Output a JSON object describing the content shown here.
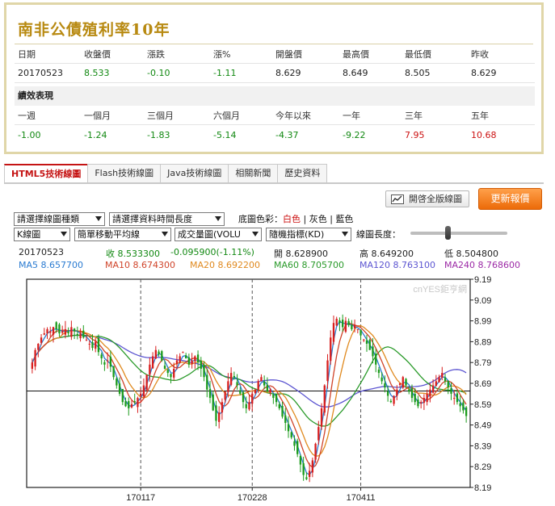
{
  "quote": {
    "title": "南非公債殖利率10年",
    "headers": [
      "日期",
      "收盤價",
      "漲跌",
      "漲%",
      "開盤價",
      "最高價",
      "最低價",
      "昨收"
    ],
    "values": [
      "20170523",
      "8.533",
      "-0.10",
      "-1.11",
      "8.629",
      "8.649",
      "8.505",
      "8.629"
    ],
    "perf_title": "績效表現",
    "perf_headers": [
      "一週",
      "一個月",
      "三個月",
      "六個月",
      "今年以來",
      "一年",
      "三年",
      "五年"
    ],
    "perf_values": [
      "-1.00",
      "-1.24",
      "-1.83",
      "-5.14",
      "-4.37",
      "-9.22",
      "7.95",
      "10.68"
    ]
  },
  "tabs": [
    "HTML5技術線圖",
    "Flash技術線圖",
    "Java技術線圖",
    "相關新聞",
    "歷史資料"
  ],
  "toolbar": {
    "full_button": "開啓全版線圖",
    "update_button": "更新報價",
    "chart_type_select": "請選擇線圖種類",
    "period_select": "請選擇資料時間長度",
    "bg_label": "底圖色彩：",
    "bg_white": "白色",
    "bg_gray": "灰色",
    "bg_blue": "藍色",
    "sep": "|",
    "kline_select": "K線圖",
    "ma_select": "簡單移動平均線",
    "volume_select": "成交量圖(VOLU",
    "random_select": "隨機指標(KD)",
    "length_label": "線圖長度："
  },
  "info": {
    "date": "20170523",
    "close": "收 8.533300",
    "change": "-0.095900(-1.11%)",
    "open": "開 8.628900",
    "high": "高 8.649200",
    "low": "低 8.504800",
    "ma5": "MA5 8.657700",
    "ma10": "MA10 8.674300",
    "ma20": "MA20 8.692200",
    "ma60": "MA60 8.705700",
    "ma120": "MA120 8.763100",
    "ma240": "MA240 8.768600"
  },
  "chart_data": {
    "type": "candlestick",
    "watermark": "cnYES鉅亨網",
    "y_ticks": [
      "9.19",
      "9.09",
      "8.99",
      "8.89",
      "8.79",
      "8.69",
      "8.59",
      "8.49",
      "8.39",
      "8.29",
      "8.19"
    ],
    "ylim": [
      8.19,
      9.19
    ],
    "x_ticks": [
      "170117",
      "170228",
      "170411"
    ],
    "current_price": 8.6533,
    "colors": {
      "up": "#d81e1e",
      "down": "#1c9b1c",
      "ma5": "#2a7bd1",
      "ma10": "#d0442a",
      "ma20": "#e08a20",
      "ma60": "#2a9a2a",
      "ma120": "#5c55d1"
    },
    "closes": [
      8.79,
      8.85,
      8.88,
      8.91,
      8.93,
      8.95,
      8.94,
      8.96,
      8.95,
      8.93,
      8.94,
      8.95,
      8.93,
      8.96,
      8.94,
      8.92,
      8.93,
      8.91,
      8.9,
      8.88,
      8.86,
      8.89,
      8.84,
      8.81,
      8.78,
      8.8,
      8.77,
      8.72,
      8.68,
      8.64,
      8.6,
      8.58,
      8.57,
      8.59,
      8.6,
      8.62,
      8.64,
      8.68,
      8.73,
      8.78,
      8.82,
      8.85,
      8.83,
      8.8,
      8.76,
      8.74,
      8.72,
      8.76,
      8.8,
      8.82,
      8.84,
      8.81,
      8.78,
      8.8,
      8.82,
      8.79,
      8.76,
      8.72,
      8.66,
      8.62,
      8.56,
      8.51,
      8.55,
      8.6,
      8.65,
      8.7,
      8.74,
      8.72,
      8.68,
      8.64,
      8.6,
      8.57,
      8.6,
      8.64,
      8.66,
      8.7,
      8.72,
      8.68,
      8.65,
      8.66,
      8.62,
      8.6,
      8.57,
      8.53,
      8.5,
      8.46,
      8.43,
      8.39,
      8.35,
      8.3,
      8.25,
      8.23,
      8.27,
      8.32,
      8.4,
      8.48,
      8.57,
      8.68,
      8.8,
      8.91,
      8.98,
      9.0,
      8.98,
      8.96,
      8.99,
      8.97,
      8.95,
      8.97,
      8.95,
      8.92,
      8.9,
      8.88,
      8.85,
      8.82,
      8.78,
      8.74,
      8.7,
      8.67,
      8.63,
      8.6,
      8.63,
      8.66,
      8.69,
      8.72,
      8.68,
      8.65,
      8.62,
      8.6,
      8.58,
      8.6,
      8.62,
      8.64,
      8.66,
      8.68,
      8.7,
      8.72,
      8.74,
      8.7,
      8.67,
      8.64,
      8.62,
      8.6,
      8.58,
      8.56,
      8.533
    ]
  }
}
